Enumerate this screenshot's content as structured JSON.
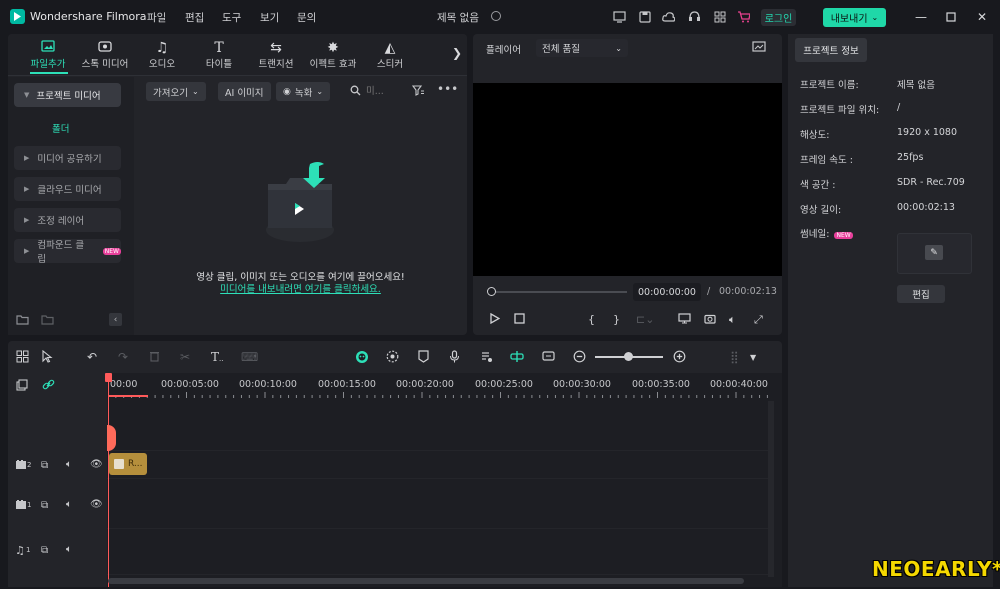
{
  "app": {
    "name": "Wondershare Filmora",
    "project_title": "제목 없음",
    "menu": [
      "파일",
      "편집",
      "도구",
      "보기",
      "문의"
    ],
    "login_label": "로그인",
    "export_label": "내보내기",
    "colors": {
      "accent": "#1fd8a8",
      "background": "#18191e",
      "panel": "#232429"
    }
  },
  "media": {
    "tabs": [
      {
        "label": "파일추가",
        "icon": "media-image-icon"
      },
      {
        "label": "스톡 미디어",
        "icon": "stock-media-icon"
      },
      {
        "label": "오디오",
        "icon": "music-note-icon"
      },
      {
        "label": "타이틀",
        "icon": "title-t-icon"
      },
      {
        "label": "트랜지션",
        "icon": "transition-icon"
      },
      {
        "label": "이펙트 효과",
        "icon": "effects-icon"
      },
      {
        "label": "스티커",
        "icon": "sticker-icon"
      }
    ],
    "sidebar": {
      "project_media": "프로젝트 미디어",
      "folder": "폴더",
      "items": [
        {
          "label": "미디어 공유하기",
          "new": false
        },
        {
          "label": "클라우드 미디어",
          "new": false
        },
        {
          "label": "조정 레이어",
          "new": false
        },
        {
          "label": "컴파운드 클립",
          "new": true
        }
      ],
      "new_badge": "NEW"
    },
    "toolbar": {
      "import_label": "가져오기",
      "ai_image_label": "AI 이미지",
      "record_label": "녹화",
      "search_placeholder": "미..."
    },
    "drop_text": "영상 클립, 이미지 또는 오디오를 여기에 끌어오세요!",
    "drop_link": "미디어를 내보내려면 여기를 클릭하세요."
  },
  "player": {
    "label": "플레이어",
    "quality": "전체 품질",
    "current_time": "00:00:00:00",
    "separator": "/",
    "total_time": "00:00:02:13",
    "progress": 0
  },
  "info": {
    "tab_label": "프로젝트 정보",
    "rows": [
      {
        "label": "프로젝트 이름:",
        "value": "제목 없음"
      },
      {
        "label": "프로젝트 파일 위치:",
        "value": "/"
      },
      {
        "label": "해상도:",
        "value": "1920 x 1080"
      },
      {
        "label": "프레임 속도 :",
        "value": "25fps"
      },
      {
        "label": "색 공간 :",
        "value": "SDR - Rec.709"
      },
      {
        "label": "영상 길이:",
        "value": "00:00:02:13"
      }
    ],
    "thumbnail_label": "썸네일:",
    "thumbnail_new_badge": "NEW",
    "edit_label": "편집"
  },
  "timeline": {
    "ruler": [
      "00:00",
      "00:00:05:00",
      "00:00:10:00",
      "00:00:15:00",
      "00:00:20:00",
      "00:00:25:00",
      "00:00:30:00",
      "00:00:35:00",
      "00:00:40:00"
    ],
    "tracks": [
      {
        "type": "video",
        "number": "2"
      },
      {
        "type": "video",
        "number": "1"
      },
      {
        "type": "audio",
        "number": "1"
      }
    ],
    "clip_label": "R..."
  },
  "watermark": "NEOEARLY*"
}
